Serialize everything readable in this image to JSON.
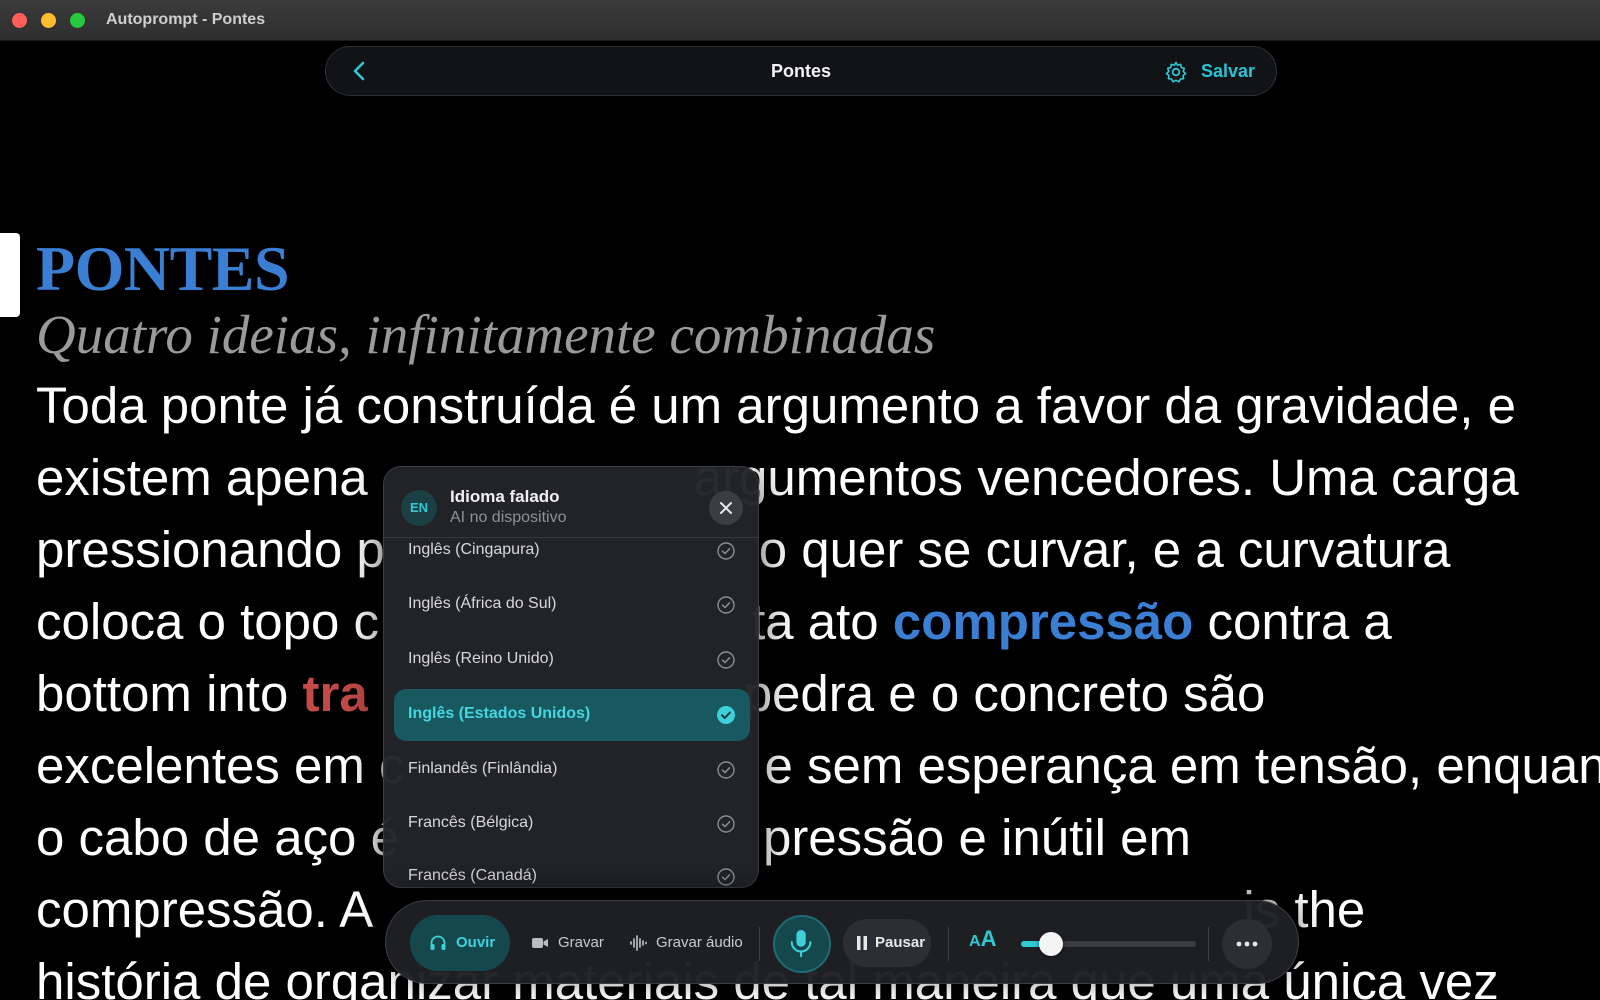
{
  "window": {
    "title": "Autoprompt - Pontes"
  },
  "nav": {
    "back_icon": "chevron-left-icon",
    "title": "Pontes",
    "settings_icon": "gear-icon",
    "save_label": "Salvar"
  },
  "document": {
    "title": "PONTES",
    "subtitle": "Quatro ideias, infinitamente combinadas",
    "lines": [
      {
        "parts": [
          "Toda ponte já construída é um argumento a favor da gravidade, e"
        ]
      },
      {
        "parts": [
          "existem apena",
          "argumentos vencedores. Uma carga"
        ]
      },
      {
        "parts": [
          "pressionando p",
          "o quer se curvar, e a curvatura"
        ]
      },
      {
        "parts": [
          "coloca o topo c",
          "ta ato ",
          "compressão",
          " contra a"
        ]
      },
      {
        "parts": [
          "bottom into ",
          "tra",
          "pedra e o concreto são"
        ]
      },
      {
        "parts": [
          "excelentes em c",
          "e sem esperança em tensão, enquanto"
        ]
      },
      {
        "parts": [
          "o cabo de aço é",
          "pressão e inútil em"
        ]
      },
      {
        "parts": [
          "compressão. A",
          "is the"
        ]
      },
      {
        "parts": [
          "história de organizar materiais de tal maneira que uma única vez"
        ]
      }
    ]
  },
  "language_popover": {
    "badge": "EN",
    "title": "Idioma falado",
    "subtitle": "AI no dispositivo",
    "close_icon": "close-icon",
    "items": [
      {
        "label": "Inglês (Cingapura)",
        "selected": false
      },
      {
        "label": "Inglês (África do Sul)",
        "selected": false
      },
      {
        "label": "Inglês (Reino Unido)",
        "selected": false
      },
      {
        "label": "Inglês (Estados Unidos)",
        "selected": true
      },
      {
        "label": "Finlandês (Finlândia)",
        "selected": false
      },
      {
        "label": "Francês (Bélgica)",
        "selected": false
      },
      {
        "label": "Francês (Canadá)",
        "selected": false
      }
    ]
  },
  "toolbar": {
    "modes": [
      {
        "label": "Ouvir",
        "icon": "headphones-icon",
        "active": true
      },
      {
        "label": "Gravar",
        "icon": "video-camera-icon",
        "active": false
      },
      {
        "label": "Gravar áudio",
        "icon": "waveform-icon",
        "active": false
      }
    ],
    "mic_icon": "microphone-icon",
    "pause_label": "Pausar",
    "text_size_small": "A",
    "text_size_big": "A",
    "text_size_level": 0.17,
    "more_icon": "ellipsis-icon"
  },
  "colors": {
    "accent": "#2fc8d4",
    "title_blue": "#3b7fd4",
    "highlight_red": "#c44a4a",
    "background": "#000000"
  }
}
